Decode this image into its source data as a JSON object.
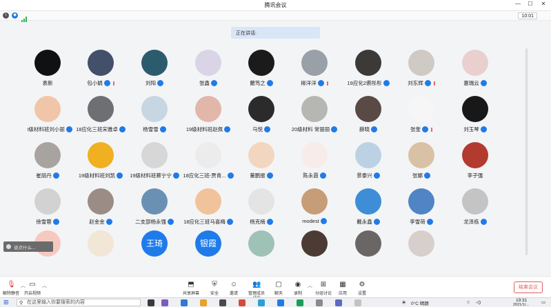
{
  "window": {
    "title": "腾讯会议",
    "clock": "10:01"
  },
  "speaking_label": "正在讲话:",
  "participants": [
    {
      "name": "袁新",
      "mic": false,
      "color": "#111111"
    },
    {
      "name": "包小娟",
      "mic": true,
      "sig": true,
      "color": "#43506a"
    },
    {
      "name": "刘阳",
      "mic": true,
      "color": "#2d5b6e"
    },
    {
      "name": "张鑫",
      "mic": true,
      "color": "#d9d4e6"
    },
    {
      "name": "藺笃之",
      "mic": true,
      "color": "#1b1b1b"
    },
    {
      "name": "柳洋洋",
      "mic": true,
      "sig": true,
      "color": "#9aa0a8"
    },
    {
      "name": "19应化2裘彤彤",
      "mic": true,
      "color": "#3c3a39"
    },
    {
      "name": "刘东辉",
      "mic": true,
      "sig": true,
      "color": "#cfcac4"
    },
    {
      "name": "惠瑞云",
      "mic": true,
      "color": "#e9d0cf"
    },
    {
      "name": "20级材料班刘小丽",
      "mic": true,
      "color": "#f1c6a8"
    },
    {
      "name": "18应化三班宋雅卓",
      "mic": true,
      "color": "#6d6f72"
    },
    {
      "name": "杨雪雪",
      "mic": true,
      "color": "#c7d6e3"
    },
    {
      "name": "19级材料班赵佩",
      "mic": true,
      "color": "#e2b6a9"
    },
    {
      "name": "马悦",
      "mic": true,
      "color": "#2b2b2b"
    },
    {
      "name": "20级材料 常丽丽",
      "mic": true,
      "color": "#b6b7b3"
    },
    {
      "name": "薛晓",
      "mic": true,
      "color": "#5a4a45"
    },
    {
      "name": "张奎",
      "mic": true,
      "sig": true,
      "color": "#f6f6f6"
    },
    {
      "name": "刘玉琴",
      "mic": true,
      "color": "#181818"
    },
    {
      "name": "崔丽丹",
      "mic": true,
      "color": "#a9a3a0"
    },
    {
      "name": "19级材料班刘凯",
      "mic": true,
      "color": "#f0b020"
    },
    {
      "name": "19级材料班蔡宁宁",
      "mic": true,
      "color": "#d7d7d7"
    },
    {
      "name": "18应化三班-贾青...",
      "mic": true,
      "color": "#ececec"
    },
    {
      "name": "董鹏振",
      "mic": true,
      "color": "#f3d6bf"
    },
    {
      "name": "陈永霞",
      "mic": true,
      "color": "#f7ecea"
    },
    {
      "name": "景泰兴",
      "mic": true,
      "color": "#bcd2e4"
    },
    {
      "name": "张娜",
      "mic": true,
      "color": "#d9c1a5"
    },
    {
      "name": "李子强",
      "mic": false,
      "color": "#b33a2e"
    },
    {
      "name": "徐雪蓉",
      "mic": true,
      "color": "#d2d2d2"
    },
    {
      "name": "赵金金",
      "mic": true,
      "color": "#9c8c86"
    },
    {
      "name": "二支部杨永强",
      "mic": true,
      "color": "#6a91b3"
    },
    {
      "name": "18应化三班马喜梅",
      "mic": true,
      "color": "#f1c39a"
    },
    {
      "name": "杨克楠",
      "mic": true,
      "color": "#e4e4e4"
    },
    {
      "name": "modest",
      "mic": true,
      "color": "#c79d77"
    },
    {
      "name": "戴永鑫",
      "mic": true,
      "color": "#3d8ed6"
    },
    {
      "name": "李雪荷",
      "mic": true,
      "color": "#4f85c4"
    },
    {
      "name": "龙泽栋",
      "mic": true,
      "color": "#c4c4c4"
    },
    {
      "name": "",
      "color": "#f6c9c0"
    },
    {
      "name": "",
      "color": "#f2e6d6"
    },
    {
      "name": "",
      "text": "王琦",
      "color": "#1f7bea"
    },
    {
      "name": "",
      "text": "银霞",
      "color": "#1f7bea"
    },
    {
      "name": "",
      "color": "#9ec2b6"
    },
    {
      "name": "",
      "color": "#4b3b34"
    },
    {
      "name": "",
      "color": "#6b6666"
    },
    {
      "name": "",
      "color": "#d7cfcc"
    }
  ],
  "chat_placeholder": "说点什么...",
  "toolbar": {
    "mute": "解除静音",
    "video": "开启视频",
    "share": "共享屏幕",
    "security": "安全",
    "invite": "邀请",
    "members": "管理成员(44)",
    "chat": "聊天",
    "record": "录制",
    "breakout": "分组讨论",
    "apps": "应用",
    "settings": "设置",
    "end": "结束会议"
  },
  "taskbar": {
    "search_placeholder": "在这里输入你要搜索的内容",
    "weather": "0°C 晴朗",
    "time": "19:31",
    "date": "2021/1/..."
  },
  "icons": {
    "info": "info-icon",
    "shield": "shield-icon",
    "signal": "signal-icon",
    "mic_off": "mic-off-icon",
    "camera": "camera-icon",
    "share": "screen-share-icon",
    "shield_tb": "shield-icon",
    "invite": "invite-icon",
    "members": "members-icon",
    "chat": "chat-icon",
    "record": "record-icon",
    "breakout": "breakout-icon",
    "apps": "apps-icon",
    "settings": "gear-icon",
    "windows": "windows-icon"
  }
}
